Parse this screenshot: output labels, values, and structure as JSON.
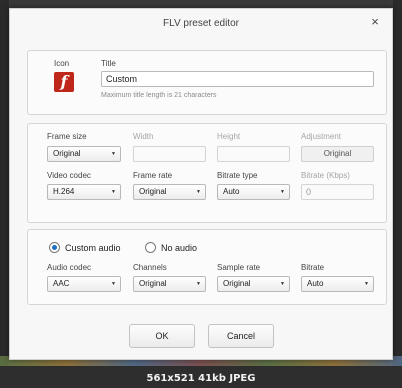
{
  "window": {
    "title": "FLV preset editor",
    "close_symbol": "×"
  },
  "preset": {
    "icon_label": "Icon",
    "icon_glyph": "f",
    "title_label": "Title",
    "title_value": "Custom",
    "title_hint": "Maximum title length is 21 characters"
  },
  "video": {
    "frame_size_label": "Frame size",
    "frame_size_value": "Original",
    "width_label": "Width",
    "width_value": "",
    "height_label": "Height",
    "height_value": "",
    "adjustment_label": "Adjustment",
    "adjustment_value": "Original",
    "codec_label": "Video codec",
    "codec_value": "H.264",
    "frame_rate_label": "Frame rate",
    "frame_rate_value": "Original",
    "bitrate_type_label": "Bitrate type",
    "bitrate_type_value": "Auto",
    "bitrate_label": "Bitrate (Kbps)",
    "bitrate_value": "0"
  },
  "audio": {
    "custom_audio_label": "Custom audio",
    "no_audio_label": "No audio",
    "codec_label": "Audio codec",
    "codec_value": "AAC",
    "channels_label": "Channels",
    "channels_value": "Original",
    "sample_rate_label": "Sample rate",
    "sample_rate_value": "Original",
    "bitrate_label": "Bitrate",
    "bitrate_value": "Auto",
    "selected": "Custom audio"
  },
  "footer": {
    "ok_label": "OK",
    "cancel_label": "Cancel"
  },
  "image_caption": "561x521  41kb  JPEG",
  "colors": {
    "accent": "#1e6fc4",
    "flash_icon": "#c0271b",
    "dialog_bg": "#f7f7f7"
  }
}
